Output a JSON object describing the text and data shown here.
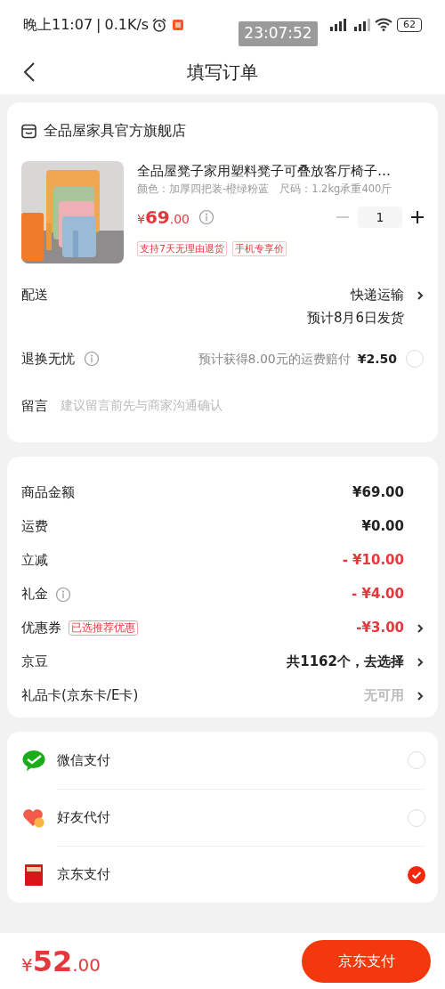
{
  "status_bar": {
    "time": "晚上11:07",
    "divider": "|",
    "speed": "0.1K/s",
    "battery": "62",
    "overlay_time": "23:07:52"
  },
  "nav": {
    "title": "填写订单"
  },
  "shop": {
    "name": "全品屋家具官方旗舰店"
  },
  "product": {
    "title": "全品屋凳子家用塑料凳子可叠放客厅椅子…",
    "spec": "颜色：加厚四把装-橙绿粉蓝　尺码：1.2kg承重400斤",
    "price_currency": "¥",
    "price_int": "69",
    "price_dec": ".00",
    "quantity": "1",
    "tags": [
      "支持7天无理由退货",
      "手机专享价"
    ]
  },
  "delivery": {
    "label": "配送",
    "method": "快递运输",
    "eta": "预计8月6日发货"
  },
  "return_insurance": {
    "label": "退换无忧",
    "note": "预计获得8.00元的运费赔付",
    "price": "¥2.50",
    "checked": false
  },
  "message": {
    "label": "留言",
    "placeholder": "建议留言前先与商家沟通确认"
  },
  "summary": [
    {
      "label": "商品金额",
      "value": "¥69.00",
      "kind": "normal",
      "info": false,
      "arrow": false
    },
    {
      "label": "运费",
      "value": "¥0.00",
      "kind": "normal",
      "info": false,
      "arrow": false
    },
    {
      "label": "立减",
      "value": "- ¥10.00",
      "kind": "discount",
      "info": false,
      "arrow": false
    },
    {
      "label": "礼金",
      "value": "- ¥4.00",
      "kind": "discount",
      "info": true,
      "arrow": false
    },
    {
      "label": "优惠券",
      "tag": "已选推荐优惠",
      "value": "-¥3.00",
      "kind": "discount",
      "info": false,
      "arrow": true
    },
    {
      "label": "京豆",
      "value": "共1162个，去选择",
      "kind": "normal",
      "info": false,
      "arrow": true
    },
    {
      "label": "礼品卡(京东卡/E卡)",
      "value": "无可用",
      "kind": "muted",
      "info": false,
      "arrow": true
    }
  ],
  "payments": [
    {
      "name": "微信支付",
      "kind": "wechat",
      "selected": false
    },
    {
      "name": "好友代付",
      "kind": "friend",
      "selected": false
    },
    {
      "name": "京东支付",
      "kind": "jd",
      "selected": true
    }
  ],
  "footer": {
    "currency": "¥",
    "total_int": "52",
    "total_dec": ".00",
    "pay_button": "京东支付"
  }
}
